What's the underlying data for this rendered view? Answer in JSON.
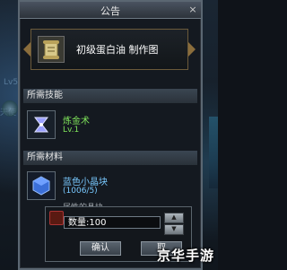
{
  "window": {
    "title": "公告",
    "close_symbol": "×"
  },
  "background": {
    "text_left_1": "Lv52 FOR周高",
    "text_left_2": "天使"
  },
  "recipe": {
    "name": "初级蛋白油 制作图",
    "icon": "scroll-icon"
  },
  "skill_section": {
    "header": "所需技能",
    "skill": {
      "name": "炼金术",
      "level": "Lv.1",
      "icon": "alchemy-icon"
    }
  },
  "material_section": {
    "header": "所需材料",
    "material": {
      "name": "蓝色小晶块",
      "count": "(1006/5)",
      "icon": "blue-crystal-icon"
    },
    "next_material_partial": "属性的晶块"
  },
  "quantity_dialog": {
    "label": "数量:",
    "value": "100",
    "display": "数量:100",
    "confirm_label": "确认",
    "cancel_label": "取"
  },
  "watermark": "京华手游",
  "colors": {
    "skill_name": "#7fe35a",
    "material_name": "#79c9ff",
    "border": "#5b6772"
  }
}
